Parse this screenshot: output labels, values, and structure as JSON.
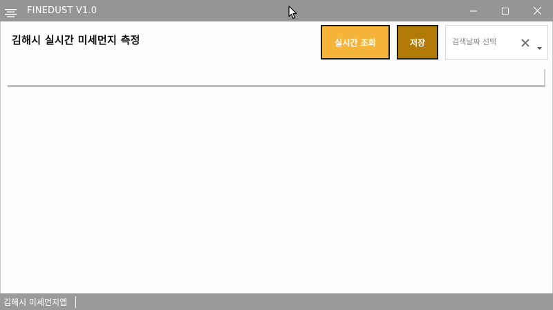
{
  "window": {
    "title": "FINEDUST V1.0",
    "app_icon": "menu-lines-icon",
    "controls": {
      "minimize_icon": "minimize-icon",
      "maximize_icon": "maximize-icon",
      "close_icon": "close-icon"
    }
  },
  "header": {
    "title": "김해시 실시간 미세먼지 측정"
  },
  "toolbar": {
    "realtime_label": "실시간 조회",
    "save_label": "저장",
    "date_picker": {
      "placeholder": "검색날짜 선택",
      "clear_icon": "clear-x-icon",
      "dropdown_icon": "chevron-down-icon"
    }
  },
  "statusbar": {
    "text": "김해시 미세먼지앱"
  },
  "colors": {
    "titlebar": "#959595",
    "realtime_button": "#f5b43a",
    "save_button": "#b07a05",
    "statusbar": "#9a9a9a"
  }
}
